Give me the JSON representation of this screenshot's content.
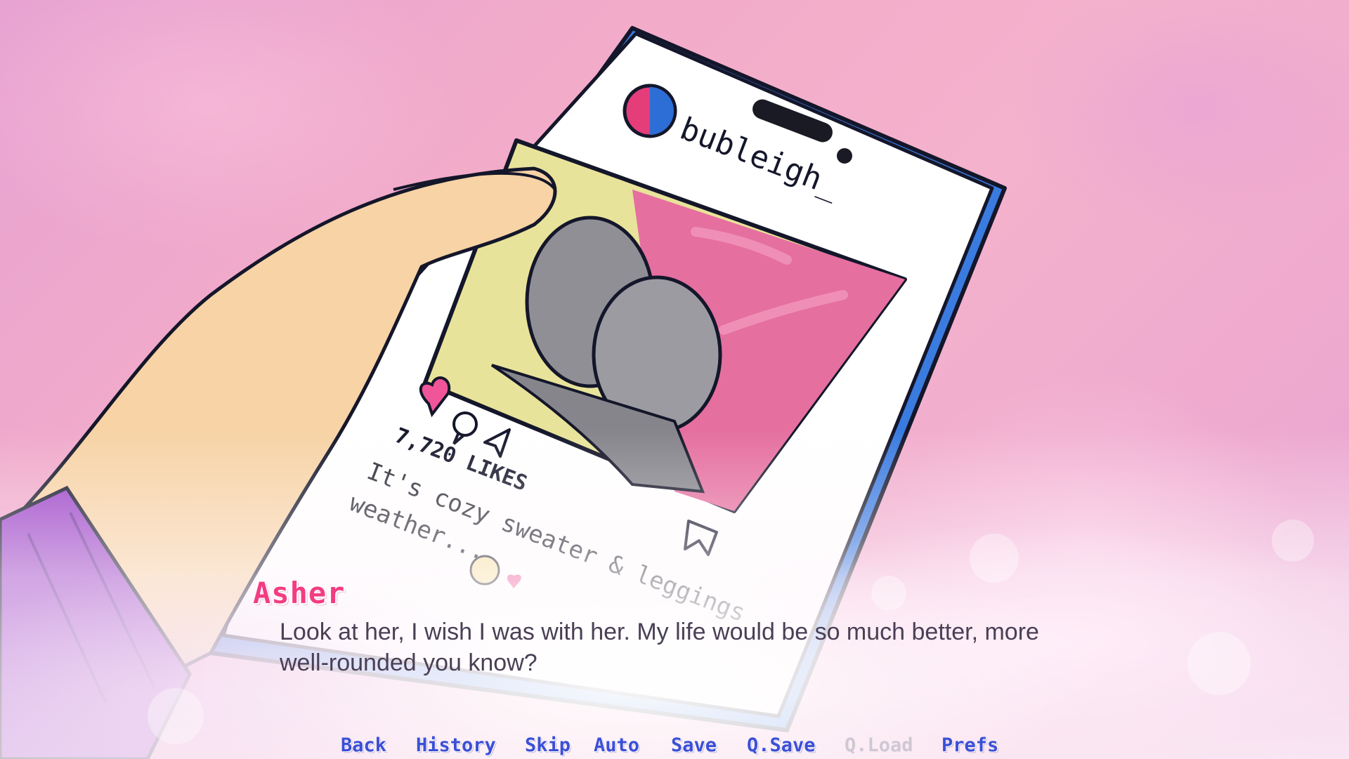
{
  "post": {
    "username": "bubleigh_",
    "likes": "7,720 LIKES",
    "caption_line1": "It's cozy sweater & leggings",
    "caption_line2": "weather..."
  },
  "dialogue": {
    "speaker": "Asher",
    "text": "Look at her, I wish I was with her. My life would be so much better, more well-rounded you know?"
  },
  "quick_menu": {
    "back": "Back",
    "history": "History",
    "skip": "Skip",
    "auto": "Auto",
    "save": "Save",
    "qsave": "Q.Save",
    "qload": "Q.Load",
    "prefs": "Prefs"
  },
  "colors": {
    "speaker": "#f23d83",
    "menu": "#3b4fd6",
    "menu_disabled": "#cfc8d4",
    "phone_frame": "#3a7be0"
  },
  "icons": [
    "heart-icon",
    "comment-icon",
    "send-icon",
    "bookmark-icon",
    "smile-emoji-icon",
    "heart-eyes-icon"
  ]
}
